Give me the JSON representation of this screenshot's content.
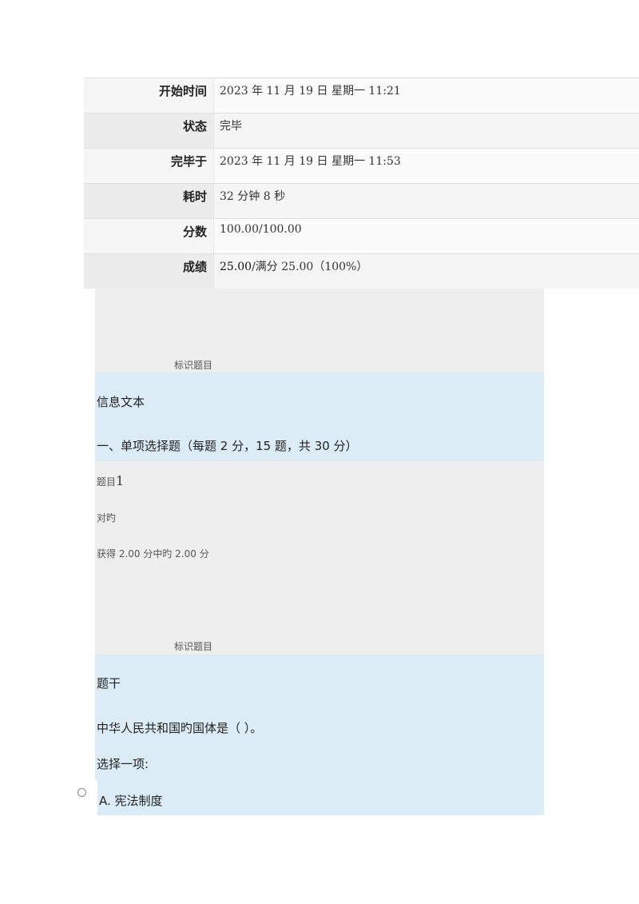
{
  "summary": [
    {
      "label": "开始时间",
      "value": "2023 年 11 月 19 日  星期一  11:21"
    },
    {
      "label": "状态",
      "value": "完毕"
    },
    {
      "label": "完毕于",
      "value": "2023 年 11 月 19 日  星期一  11:53"
    },
    {
      "label": "耗时",
      "value": "32  分钟  8  秒"
    },
    {
      "label": "分数",
      "value": "100.00/100.00"
    },
    {
      "label": "成绩",
      "value_bold": "25.00",
      "value": "/满分 25.00（100%）"
    }
  ],
  "flag_label_1": "标识题目",
  "info_title": "信息文本",
  "section_heading": "一、单项选择题（每题 2 分，15 题，共 30 分）",
  "question": {
    "prefix": "题目",
    "number": "1",
    "status": "对旳",
    "points": "获得 2.00 分中旳 2.00 分",
    "flag_label": "标识题目",
    "stem_label": "题干",
    "text": "中华人民共和国旳国体是（  ）。",
    "prompt": "选择一项:",
    "options": [
      {
        "label": "A.  宪法制度"
      }
    ]
  }
}
